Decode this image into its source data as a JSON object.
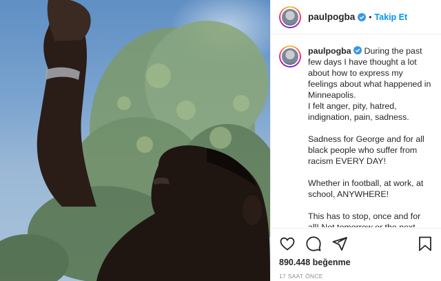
{
  "post": {
    "username": "paulpogba",
    "verified": true,
    "separator": "•",
    "follow_label": "Takip Et"
  },
  "caption": {
    "username": "paulpogba",
    "text": "During the past few days I have thought a lot about how to express my feelings about what happened in Minneapolis.\nI felt anger, pity, hatred, indignation, pain, sadness.\n\nSadness for George and for all black people who suffer from racism EVERY DAY!\n\nWhether in football, at work, at school, ANYWHERE!\n\nThis has to stop, once and for all! Not tomorrow or the next day, it has to end TODAY!\n\nViolent acts of racism can no longer be tolerated."
  },
  "actions": {
    "icons": [
      "heart-icon",
      "comment-icon",
      "share-icon",
      "bookmark-icon"
    ],
    "likes": "890.448 beğenme",
    "time_ago": "17 SAAT ÖNCE"
  },
  "colors": {
    "accent": "#0095f6",
    "verified": "#3897f0",
    "text": "#262626",
    "muted": "#8e8e8e",
    "border": "#efefef"
  }
}
